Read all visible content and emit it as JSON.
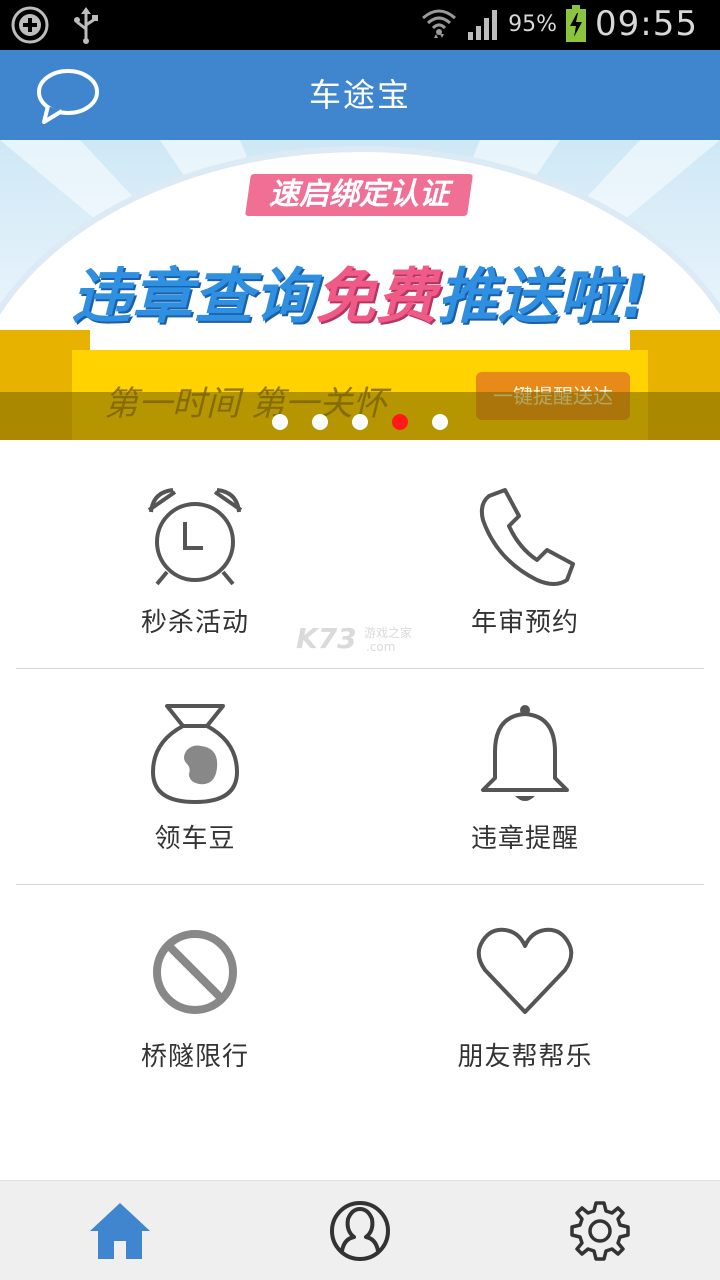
{
  "status_bar": {
    "battery_percent": "95%",
    "time": "09:55",
    "icons": [
      "add-circle-icon",
      "usb-icon",
      "wifi-icon",
      "signal-icon",
      "battery-charging-icon"
    ]
  },
  "header": {
    "title": "车途宝",
    "left_icon": "message-bubble-icon"
  },
  "banner": {
    "tag": "速启绑定认证",
    "headline_part1": "违章查询",
    "headline_highlight": "免费",
    "headline_part2": "推送啦!",
    "slogan": "第一时间  第一关怀",
    "cta": "一键提醒送达",
    "pager": {
      "count": 5,
      "active_index": 3
    },
    "colors": {
      "headline": "#2f8fe0",
      "highlight": "#ef5a86",
      "ribbon": "#ffd200",
      "active_dot": "#ff1a1a"
    }
  },
  "grid": {
    "items": [
      {
        "label": "秒杀活动",
        "icon": "alarm-clock-icon"
      },
      {
        "label": "年审预约",
        "icon": "phone-icon"
      },
      {
        "label": "领车豆",
        "icon": "bean-bag-icon"
      },
      {
        "label": "违章提醒",
        "icon": "bell-icon"
      },
      {
        "label": "桥隧限行",
        "icon": "no-entry-icon"
      },
      {
        "label": "朋友帮帮乐",
        "icon": "heart-icon"
      }
    ]
  },
  "watermark": {
    "brand": "K73",
    "tagline": "游戏之家",
    "domain": ".com"
  },
  "bottom_nav": {
    "items": [
      {
        "name": "home",
        "icon": "home-icon",
        "active": true
      },
      {
        "name": "profile",
        "icon": "user-icon",
        "active": false
      },
      {
        "name": "settings",
        "icon": "gear-icon",
        "active": false
      }
    ],
    "colors": {
      "active": "#3f86cf",
      "inactive": "#333333"
    }
  },
  "theme": {
    "primary": "#3f86cf"
  }
}
